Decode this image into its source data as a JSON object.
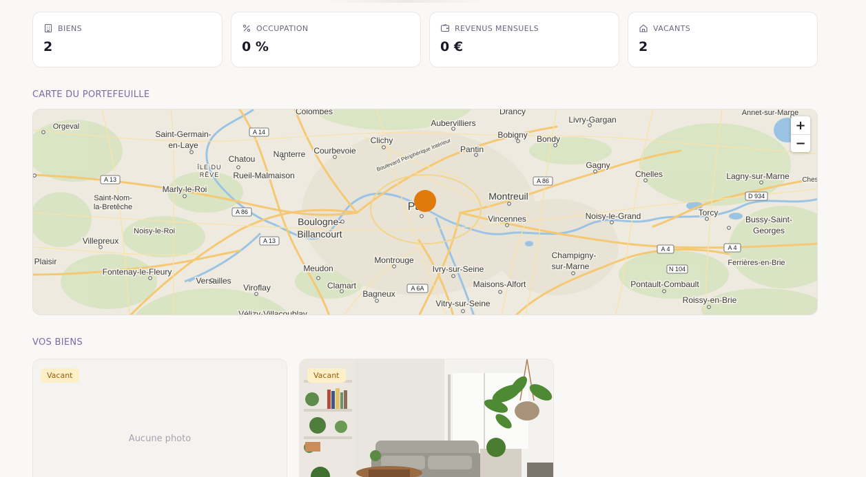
{
  "stats": [
    {
      "icon": "building-icon",
      "label": "BIENS",
      "value": "2"
    },
    {
      "icon": "percent-icon",
      "label": "OCCUPATION",
      "value": "0 %"
    },
    {
      "icon": "wallet-icon",
      "label": "REVENUS MENSUELS",
      "value": "0 €"
    },
    {
      "icon": "home-icon",
      "label": "VACANTS",
      "value": "2"
    }
  ],
  "map_section": {
    "title": "CARTE DU PORTEFEUILLE"
  },
  "map": {
    "zoom_in": "+",
    "zoom_out": "−",
    "places": {
      "colombes": "Colombes",
      "orgeval": "Orgeval",
      "saint_germain_1": "Saint-Germain-",
      "saint_germain_2": "en-Laye",
      "chatou": "Chatou",
      "nanterre": "Nanterre",
      "courbevoie": "Courbevoie",
      "clichy": "Clichy",
      "aubervilliers": "Aubervilliers",
      "drancy": "Drancy",
      "bobigny": "Bobigny",
      "bondy": "Bondy",
      "livry": "Livry-Gargan",
      "annet": "Annet-sur-Marne",
      "pantin": "Pantin",
      "ile1": "ÎLE DU",
      "ile2": "RÊVE",
      "rueil": "Rueil-Malmaison",
      "gagny": "Gagny",
      "chelles": "Chelles",
      "lagny": "Lagny-sur-Marne",
      "marly": "Marly-le-Roi",
      "saint_nom_1": "Saint-Nom-",
      "saint_nom_2": "la-Bretêche",
      "paris": "Paris",
      "montreuil": "Montreuil",
      "boulogne_1": "Boulogne-",
      "boulogne_2": "Billancourt",
      "noisy_roi": "Noisy-le-Roi",
      "vincennes": "Vincennes",
      "noisy_grand": "Noisy-le-Grand",
      "torcy": "Torcy",
      "bussy_1": "Bussy-Saint-",
      "bussy_2": "Georges",
      "villepreux": "Villepreux",
      "plaisir": "Plaisir",
      "champigny_1": "Champigny-",
      "champigny_2": "sur-Marne",
      "montrouge": "Montrouge",
      "ivry": "Ivry-sur-Seine",
      "meudon": "Meudon",
      "fontenay": "Fontenay-le-Fleury",
      "versailles": "Versailles",
      "viroflay": "Viroflay",
      "clamart": "Clamart",
      "maisons": "Maisons-Alfort",
      "pontault": "Pontault-Combault",
      "ferrieres": "Ferrières-en-Brie",
      "bagneux": "Bagneux",
      "vitry": "Vitry-sur-Seine",
      "roissy": "Roissy-en-Brie",
      "velizy": "Vélizy-Villacoublay",
      "ches": "Ches",
      "periph": "Boulevard Périphérique Intérieur"
    },
    "roads": {
      "a14": "A 14",
      "a13a": "A 13",
      "a86a": "A 86",
      "a13b": "A 13",
      "a86b": "A 86",
      "a6a": "A 6A",
      "a4a": "A 4",
      "a4b": "A 4",
      "n104": "N 104",
      "d934": "D 934"
    }
  },
  "properties_section": {
    "title": "VOS BIENS"
  },
  "properties": [
    {
      "status": "Vacant",
      "photo_placeholder": "Aucune photo"
    },
    {
      "status": "Vacant"
    }
  ],
  "colors": {
    "accent": "#7a6ba3",
    "marker": "#e07a0a",
    "badge_bg": "#fdf0c8",
    "badge_text": "#a05a08"
  }
}
